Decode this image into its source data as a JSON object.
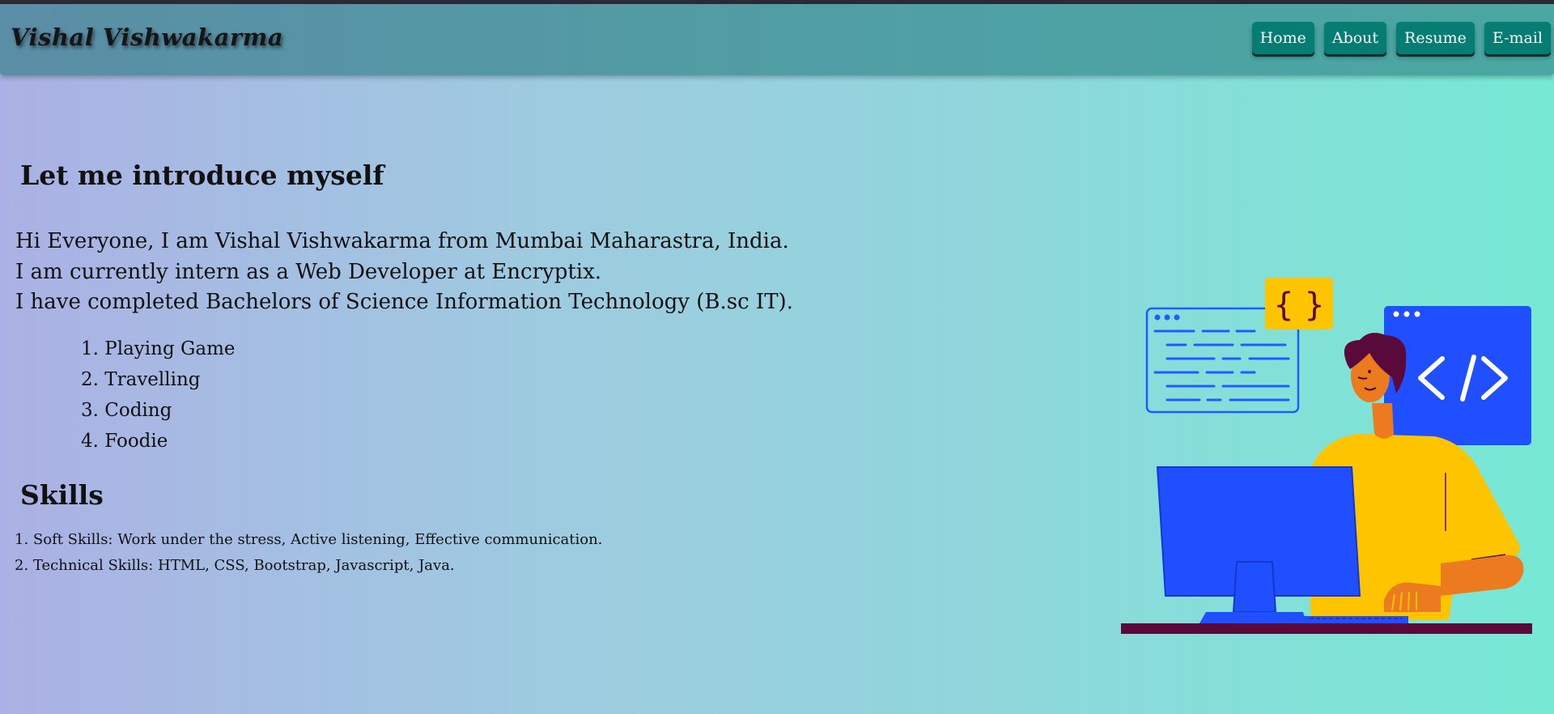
{
  "navbar": {
    "brand": "Vishal Vishwakarma",
    "links": [
      {
        "label": "Home"
      },
      {
        "label": "About"
      },
      {
        "label": "Resume"
      },
      {
        "label": "E-mail"
      }
    ]
  },
  "intro": {
    "heading": "Let me introduce myself",
    "lines": [
      "Hi Everyone, I am Vishal Vishwakarma from Mumbai Maharastra, India.",
      "I am currently intern as a Web Developer at Encryptix.",
      "I have completed Bachelors of Science Information Technology (B.sc IT)."
    ],
    "hobbies": [
      {
        "num": "1.",
        "label": "Playing Game"
      },
      {
        "num": "2.",
        "label": "Travelling"
      },
      {
        "num": "3.",
        "label": "Coding"
      },
      {
        "num": "4.",
        "label": "Foodie"
      }
    ]
  },
  "skills": {
    "heading": "Skills",
    "items": [
      "1. Soft Skills: Work under the stress, Active listening, Effective communication.",
      "2. Technical Skills: HTML, CSS, Bootstrap, Javascript, Java."
    ]
  },
  "illustration": {
    "icon": "developer-at-computer-illustration",
    "code_braces_text": "{ }"
  },
  "colors": {
    "nav_button": "#057d73",
    "illustration_blue": "#1f4fff",
    "illustration_yellow": "#ffc400"
  }
}
